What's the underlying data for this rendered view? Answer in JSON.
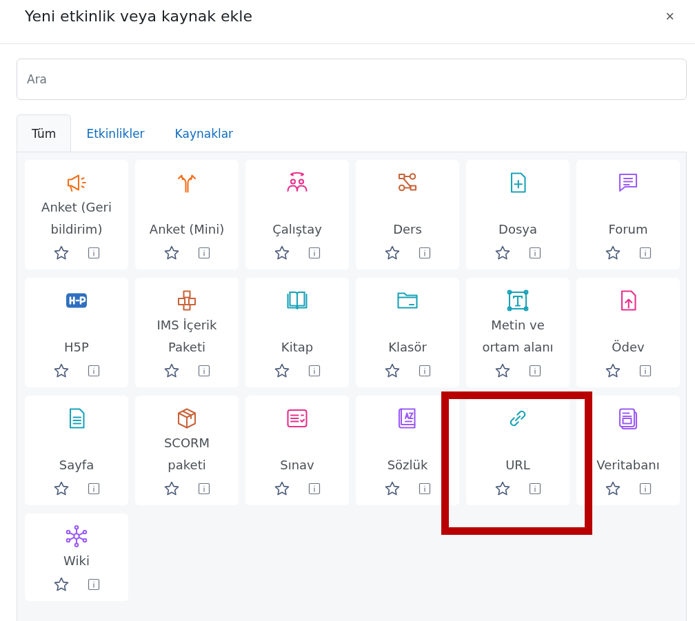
{
  "dialog": {
    "title": "Yeni etkinlik veya kaynak ekle",
    "close": "×"
  },
  "search": {
    "placeholder": "Ara"
  },
  "tabs": [
    {
      "label": "Tüm",
      "selected": true
    },
    {
      "label": "Etkinlikler",
      "selected": false
    },
    {
      "label": "Kaynaklar",
      "selected": false
    }
  ],
  "items": [
    {
      "label": "Anket (Geri bildirim)",
      "starred": false,
      "highlighted": false
    },
    {
      "label": "Anket (Mini)",
      "starred": false,
      "highlighted": false
    },
    {
      "label": "Çalıştay",
      "starred": false,
      "highlighted": false
    },
    {
      "label": "Ders",
      "starred": false,
      "highlighted": false
    },
    {
      "label": "Dosya",
      "starred": false,
      "highlighted": false
    },
    {
      "label": "Forum",
      "starred": false,
      "highlighted": false
    },
    {
      "label": "H5P",
      "starred": false,
      "highlighted": false
    },
    {
      "label": "IMS İçerik Paketi",
      "starred": false,
      "highlighted": false
    },
    {
      "label": "Kitap",
      "starred": false,
      "highlighted": false
    },
    {
      "label": "Klasör",
      "starred": false,
      "highlighted": false
    },
    {
      "label": "Metin ve ortam alanı",
      "starred": false,
      "highlighted": false
    },
    {
      "label": "Ödev",
      "starred": false,
      "highlighted": false
    },
    {
      "label": "Sayfa",
      "starred": false,
      "highlighted": false
    },
    {
      "label": "SCORM paketi",
      "starred": false,
      "highlighted": false
    },
    {
      "label": "Sınav",
      "starred": false,
      "highlighted": false
    },
    {
      "label": "Sözlük",
      "starred": false,
      "highlighted": false
    },
    {
      "label": "URL",
      "starred": false,
      "highlighted": true
    },
    {
      "label": "Veritabanı",
      "starred": false,
      "highlighted": false
    },
    {
      "label": "Wiki",
      "starred": false,
      "highlighted": false
    }
  ]
}
